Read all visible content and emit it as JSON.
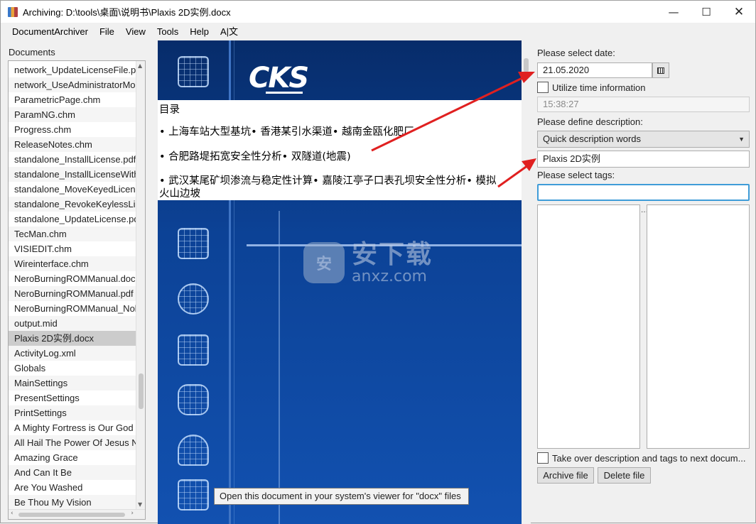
{
  "window": {
    "title": "Archiving: D:\\tools\\桌面\\说明书\\Plaxis 2D实例.docx",
    "minimize_glyph": "—",
    "maximize_glyph": "☐",
    "close_glyph": "✕"
  },
  "menu": [
    "DocumentArchiver",
    "File",
    "View",
    "Tools",
    "Help",
    "A|文"
  ],
  "documents": {
    "label": "Documents",
    "items": [
      "network_UpdateLicenseFile.pd",
      "network_UseAdministratorMo",
      "ParametricPage.chm",
      "ParamNG.chm",
      "Progress.chm",
      "ReleaseNotes.chm",
      "standalone_InstallLicense.pdf",
      "standalone_InstallLicenseWith",
      "standalone_MoveKeyedLicens",
      "standalone_RevokeKeylessLice",
      "standalone_UpdateLicense.pd",
      "TecMan.chm",
      "VISIEDIT.chm",
      "Wireinterface.chm",
      "NeroBurningROMManual.doc",
      "NeroBurningROMManual.pdf",
      "NeroBurningROMManual_Nol",
      "output.mid",
      "Plaxis 2D实例.docx",
      "ActivityLog.xml",
      "Globals",
      "MainSettings",
      "PresentSettings",
      "PrintSettings",
      "A Mighty Fortress is Our God",
      "All Hail The Power Of Jesus Na",
      "Amazing Grace",
      "And Can It Be",
      "Are You Washed",
      "Be Thou My Vision"
    ],
    "selected": "Plaxis 2D实例.docx"
  },
  "preview": {
    "logo": "CKS",
    "lines": [
      "目录",
      "• 上海车站大型基坑• 香港某引水渠道• 越南金瓯化肥厂",
      "• 合肥路堤拓宽安全性分析• 双隧道(地震)",
      "• 武汉某尾矿坝渗流与稳定性计算• 嘉陵江亭子口表孔坝安全性分析• 模拟",
      "火山边坡"
    ],
    "watermark_big": "安下载",
    "watermark_small": "anxz.com",
    "watermark_badge": "安",
    "tooltip": "Open this document in your system's viewer for \"docx\" files"
  },
  "form": {
    "date_label": "Please select date:",
    "date_value": "21.05.2020",
    "time_checkbox_label": "Utilize time information",
    "time_value": "15:38:27",
    "description_label": "Please define description:",
    "quick_description": "Quick description words",
    "description_value": "Plaxis 2D实例",
    "tags_label": "Please select tags:",
    "tags_value": "",
    "take_over_label": "Take over description and tags to next docum...",
    "archive_button": "Archive file",
    "delete_button": "Delete file"
  },
  "colors": {
    "annotation_arrow": "#e02020",
    "focus_border": "#3f9cd8",
    "selected_row": "#cccccc"
  }
}
